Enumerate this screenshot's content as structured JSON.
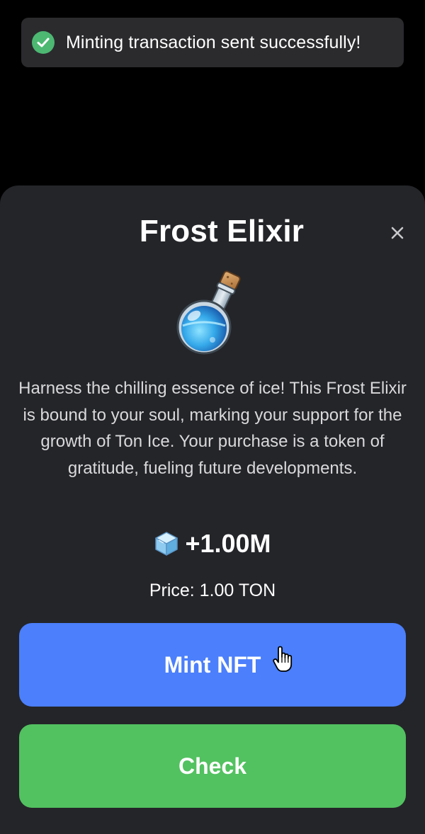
{
  "toast": {
    "message": "Minting transaction sent successfully!",
    "icon": "check-circle-icon",
    "color": "#4cb872"
  },
  "modal": {
    "title": "Frost Elixir",
    "close_icon": "close-icon",
    "image_icon": "potion-icon",
    "description": "Harness the chilling essence of ice! This Frost Elixir is bound to your soul, marking your support for the growth of Ton Ice. Your purchase is a token of gratitude, fueling future developments.",
    "reward": {
      "icon": "ice-cube-icon",
      "amount": "+1.00M"
    },
    "price": "Price: 1.00 TON",
    "buttons": {
      "mint_label": "Mint NFT",
      "mint_color": "#4b7ffb",
      "check_label": "Check",
      "check_color": "#52c160"
    }
  }
}
